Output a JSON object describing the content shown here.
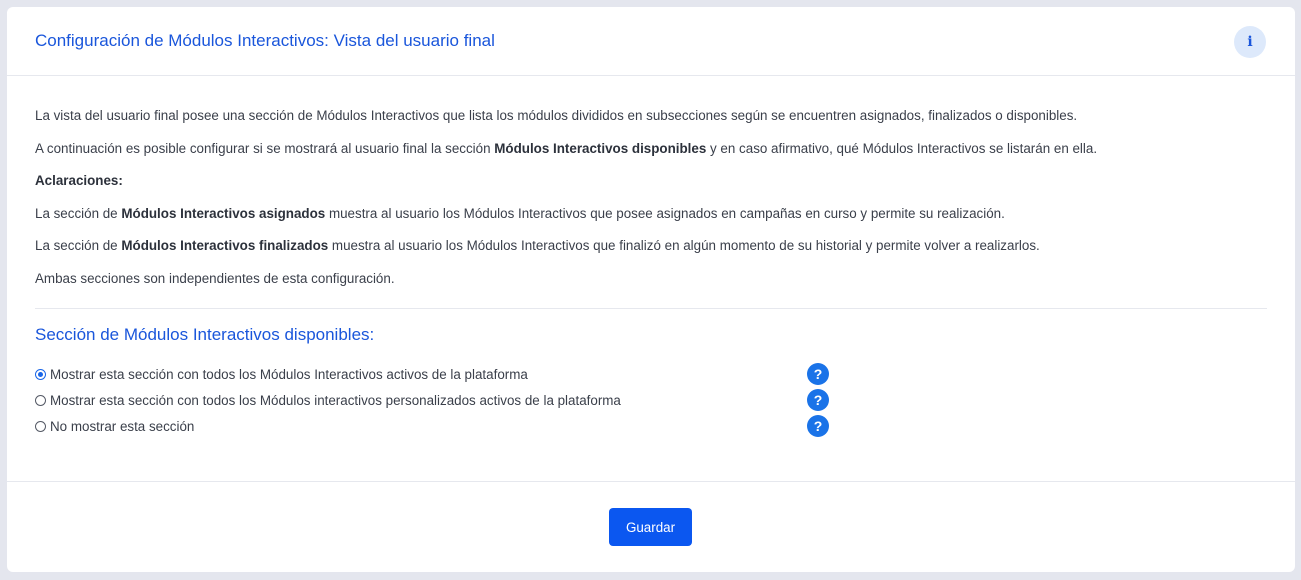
{
  "header": {
    "title": "Configuración de Módulos Interactivos: Vista del usuario final",
    "info_icon": "i"
  },
  "intro": {
    "p1": "La vista del usuario final posee una sección de Módulos Interactivos que lista los módulos divididos en subsecciones según se encuentren asignados, finalizados o disponibles.",
    "p2_pre": "A continuación es posible configurar si se mostrará al usuario final la sección ",
    "p2_bold": "Módulos Interactivos disponibles",
    "p2_post": " y en caso afirmativo, qué Módulos Interactivos se listarán en ella.",
    "aclaraciones": "Aclaraciones:",
    "p3_pre": "La sección de ",
    "p3_bold": "Módulos Interactivos asignados",
    "p3_post": " muestra al usuario los Módulos Interactivos que posee asignados en campañas en curso y permite su realización.",
    "p4_pre": "La sección de ",
    "p4_bold": "Módulos Interactivos finalizados",
    "p4_post": " muestra al usuario los Módulos Interactivos que finalizó en algún momento de su historial y permite volver a realizarlos.",
    "p5": "Ambas secciones son independientes de esta configuración."
  },
  "section": {
    "title": "Sección de Módulos Interactivos disponibles:",
    "options": [
      {
        "label": "Mostrar esta sección con todos los Módulos Interactivos activos de la plataforma",
        "checked": true
      },
      {
        "label": "Mostrar esta sección con todos los Módulos interactivos personalizados activos de la plataforma",
        "checked": false
      },
      {
        "label": "No mostrar esta sección",
        "checked": false
      }
    ],
    "help_glyph": "?"
  },
  "footer": {
    "save_label": "Guardar"
  },
  "colors": {
    "accent": "#1a56db",
    "button": "#0b57f0",
    "help_icon": "#1a73e8",
    "background": "#e4e6ee"
  }
}
